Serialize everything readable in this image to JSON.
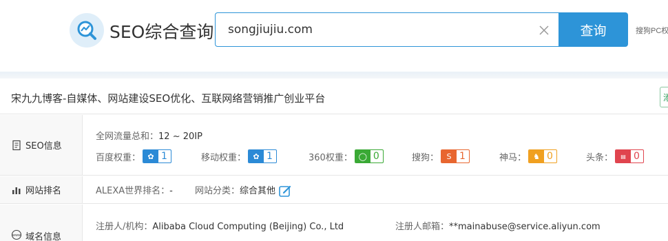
{
  "header": {
    "logo_text": "SEO综合查询",
    "search_value": "songjiujiu.com",
    "search_button": "查询",
    "side_link": "搜狗PC权"
  },
  "title_row": {
    "site_title": "宋九九博客-自媒体、网站建设SEO优化、互联网络营销推广创业平台",
    "right_button": "添"
  },
  "seo_info": {
    "label": "SEO信息",
    "traffic_label": "全网流量总和：",
    "traffic_value": "12 ~ 20IP",
    "ranks": [
      {
        "label": "百度权重：",
        "value": "1",
        "icon": "baidu-paw-icon",
        "color": "#2b8ad6"
      },
      {
        "label": "移动权重：",
        "value": "1",
        "icon": "mobile-paw-icon",
        "color": "#2b8ad6"
      },
      {
        "label": "360权重：",
        "value": "0",
        "icon": "360-icon",
        "color": "#3aa935"
      },
      {
        "label": "搜狗：",
        "value": "1",
        "icon": "sogou-icon",
        "color": "#e8662f"
      },
      {
        "label": "神马：",
        "value": "0",
        "icon": "shenma-icon",
        "color": "#f0a020"
      },
      {
        "label": "头条：",
        "value": "0",
        "icon": "toutiao-icon",
        "color": "#e0444e"
      }
    ]
  },
  "site_rank": {
    "label": "网站排名",
    "alexa_label": "ALEXA世界排名：",
    "alexa_value": "-",
    "category_label": "网站分类：",
    "category_value": "综合其他"
  },
  "domain_info": {
    "label": "域名信息",
    "registrant_label": "注册人/机构：",
    "registrant_value": "Alibaba Cloud Computing (Beijing) Co., Ltd",
    "email_label": "注册人邮箱：",
    "email_value": "**mainabuse@service.aliyun.com"
  }
}
